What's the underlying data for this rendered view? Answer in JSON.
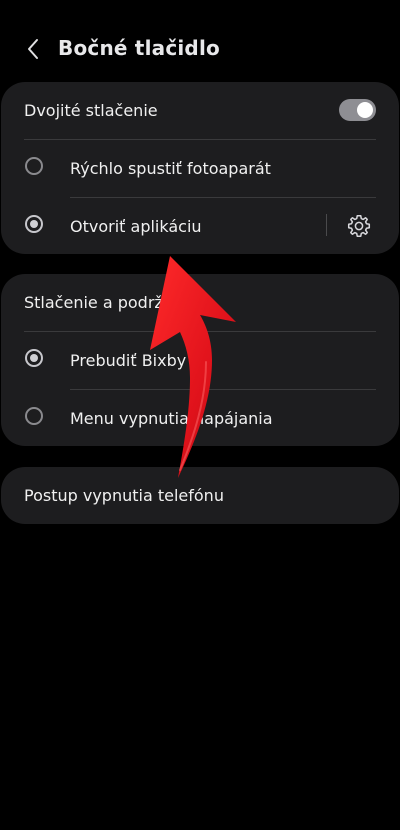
{
  "header": {
    "back_icon": "chevron-left-icon",
    "title": "Bočné tlačidlo"
  },
  "double_press": {
    "title": "Dvojité stlačenie",
    "toggle_on": true,
    "options": [
      {
        "label": "Rýchlo spustiť fotoaparát",
        "selected": false
      },
      {
        "label": "Otvoriť aplikáciu",
        "selected": true,
        "settings_icon": "gear-icon"
      }
    ]
  },
  "press_hold": {
    "title": "Stlačenie a podrž",
    "options": [
      {
        "label": "Prebudiť Bixby",
        "selected": true
      },
      {
        "label": "Menu vypnutia napájania",
        "selected": false
      }
    ]
  },
  "shutdown": {
    "label": "Postup vypnutia telefónu"
  },
  "colors": {
    "background": "#000000",
    "card": "#1d1d1f",
    "text": "#f0f0f0",
    "annotation_arrow": "#e0121b"
  }
}
